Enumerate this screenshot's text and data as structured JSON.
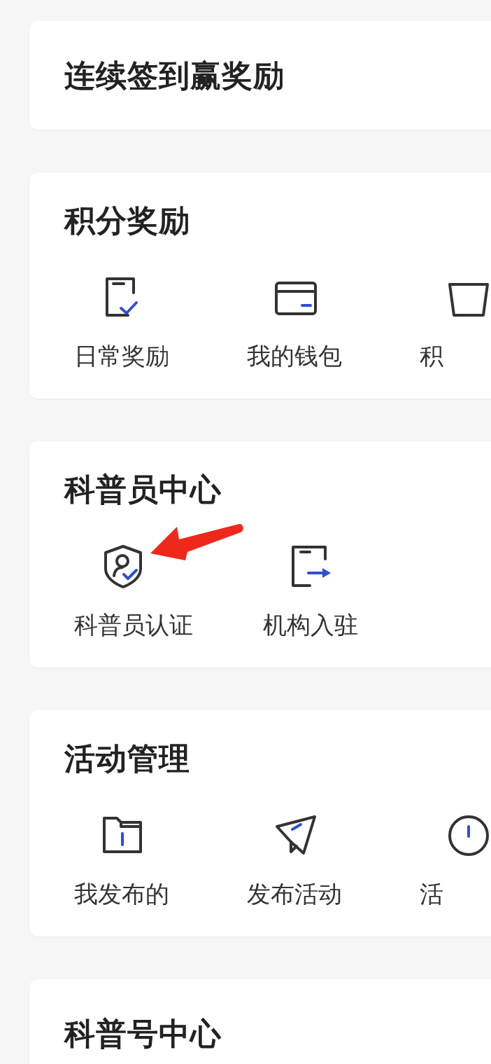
{
  "sections": [
    {
      "title": "连续签到赢奖励"
    },
    {
      "title": "积分奖励",
      "items": [
        {
          "label": "日常奖励"
        },
        {
          "label": "我的钱包"
        },
        {
          "label": "积"
        }
      ]
    },
    {
      "title": "科普员中心",
      "items": [
        {
          "label": "科普员认证"
        },
        {
          "label": "机构入驻"
        }
      ]
    },
    {
      "title": "活动管理",
      "items": [
        {
          "label": "我发布的"
        },
        {
          "label": "发布活动"
        },
        {
          "label": "活"
        }
      ]
    },
    {
      "title": "科普号中心"
    }
  ]
}
